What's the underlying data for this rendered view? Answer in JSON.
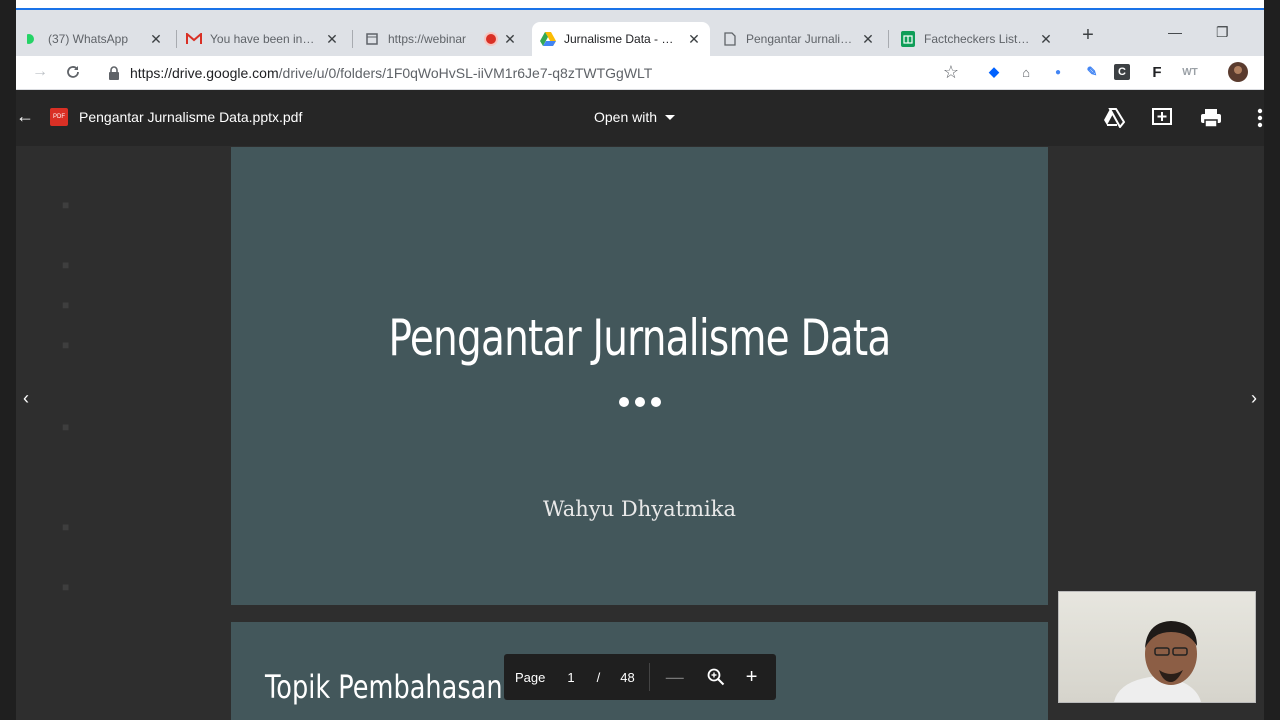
{
  "browser": {
    "tabs": [
      {
        "label": "(37) WhatsApp",
        "icon": "whatsapp-icon"
      },
      {
        "label": "You have been invited",
        "icon": "gmail-icon"
      },
      {
        "label": "https://webinar",
        "icon": "page-icon"
      },
      {
        "label": "Jurnalisme Data - Google Drive",
        "icon": "google-drive-icon"
      },
      {
        "label": "Pengantar Jurnalisme Data",
        "icon": "document-icon"
      },
      {
        "label": "Factcheckers List for",
        "icon": "google-sheets-icon"
      }
    ],
    "new_tab": "+",
    "address": {
      "host": "https://drive.google.com",
      "path": "/drive/u/0/folders/1F0qWoHvSL-iiVM1r6Je7-q8zTWTGgWLT"
    },
    "extensions": [
      "dropbox-icon",
      "extension-icon",
      "extension-icon",
      "pen-icon",
      "c-icon",
      "f-icon",
      "wt-icon",
      "avatar"
    ],
    "colors": {
      "accent": "#1a73e8",
      "record": "#d93025"
    }
  },
  "viewer": {
    "file_name": "Pengantar Jurnalisme Data.pptx.pdf",
    "open_with": "Open with",
    "pager": {
      "label": "Page",
      "current": "1",
      "separator": "/",
      "total": "48"
    }
  },
  "slides": [
    {
      "title": "Pengantar Jurnalisme Data",
      "subtitle": "Wahyu Dhyatmika"
    },
    {
      "title": "Topik Pembahasan"
    }
  ],
  "colors": {
    "slide_bg": "#43575b",
    "viewer_bg": "#2e2e2e"
  }
}
